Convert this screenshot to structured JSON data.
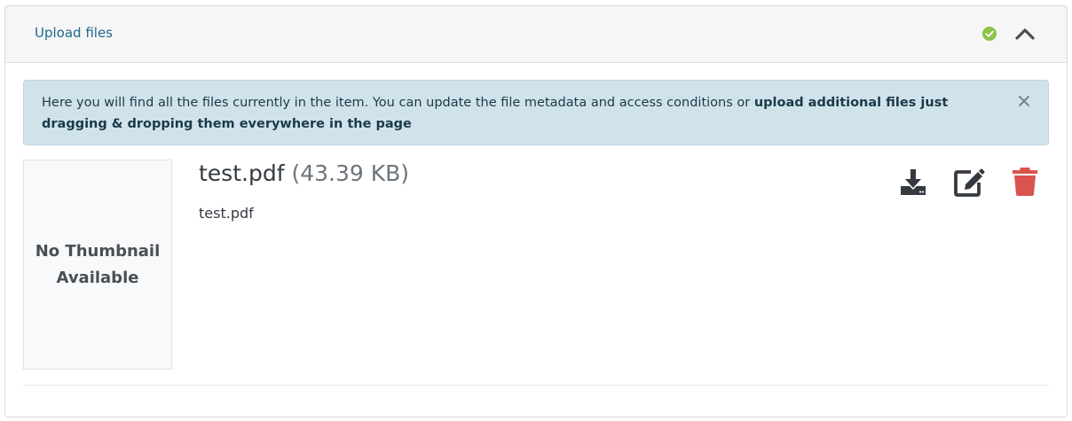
{
  "header": {
    "title": "Upload files",
    "status_icon": "check-circle-icon",
    "status_color": "#8bc34a",
    "collapse_icon": "chevron-up-icon"
  },
  "alert": {
    "text_plain": "Here you will find all the files currently in the item. You can update the file metadata and access conditions or ",
    "text_bold": "upload additional files just dragging & dropping them everywhere in the page",
    "close_icon": "close-icon"
  },
  "file": {
    "thumbnail_text_line1": "No Thumbnail",
    "thumbnail_text_line2": "Available",
    "name": "test.pdf",
    "size": "(43.39 KB)",
    "description": "test.pdf",
    "actions": [
      {
        "name": "download",
        "icon": "download-icon",
        "color": "#343a40"
      },
      {
        "name": "edit",
        "icon": "edit-icon",
        "color": "#343a40"
      },
      {
        "name": "delete",
        "icon": "trash-icon",
        "color": "#d9534f"
      }
    ]
  }
}
